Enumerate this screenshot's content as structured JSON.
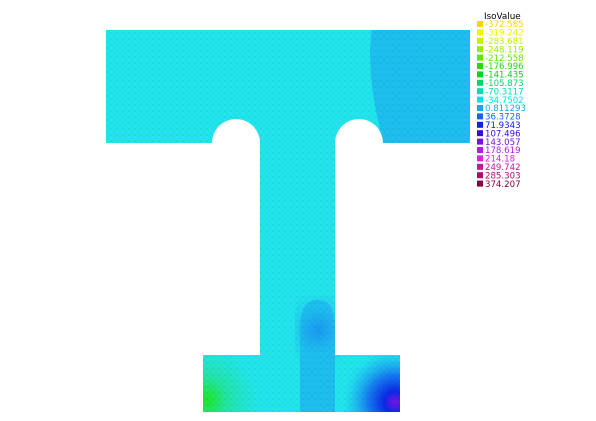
{
  "legend": {
    "title": "IsoValue",
    "entries": [
      {
        "label": "-372.585",
        "color": "#ffd500"
      },
      {
        "label": "-319.242",
        "color": "#f4f400"
      },
      {
        "label": "-283.681",
        "color": "#c4f400"
      },
      {
        "label": "-248.119",
        "color": "#96ee00"
      },
      {
        "label": "-212.558",
        "color": "#5ee800"
      },
      {
        "label": "-176.996",
        "color": "#20e000"
      },
      {
        "label": "-141.435",
        "color": "#00d61c"
      },
      {
        "label": "-105.873",
        "color": "#00d66a"
      },
      {
        "label": "-70.3117",
        "color": "#00dcb4"
      },
      {
        "label": "-34.7502",
        "color": "#00e4e8"
      },
      {
        "label": "0.811293",
        "color": "#14a8f0"
      },
      {
        "label": "36.3728",
        "color": "#1066f2"
      },
      {
        "label": "71.9343",
        "color": "#0a22ee"
      },
      {
        "label": "107.496",
        "color": "#3a0ae6"
      },
      {
        "label": "143.057",
        "color": "#7a12e4"
      },
      {
        "label": "178.619",
        "color": "#b01ee2"
      },
      {
        "label": "214.18",
        "color": "#d426d6"
      },
      {
        "label": "249.742",
        "color": "#c01896"
      },
      {
        "label": "285.303",
        "color": "#aa0c6a"
      },
      {
        "label": "374.207",
        "color": "#8a0040"
      }
    ]
  },
  "field_colors": {
    "base": "#22e6ee",
    "zone_low": "#1ec0f0",
    "zone_mid": "#1678f2",
    "zone_high": "#0a2ae8",
    "peak": "#7a14e4",
    "green_strong": "#1ee81a",
    "green_soft": "#22e6a0",
    "green_teal": "#22e6cc"
  }
}
